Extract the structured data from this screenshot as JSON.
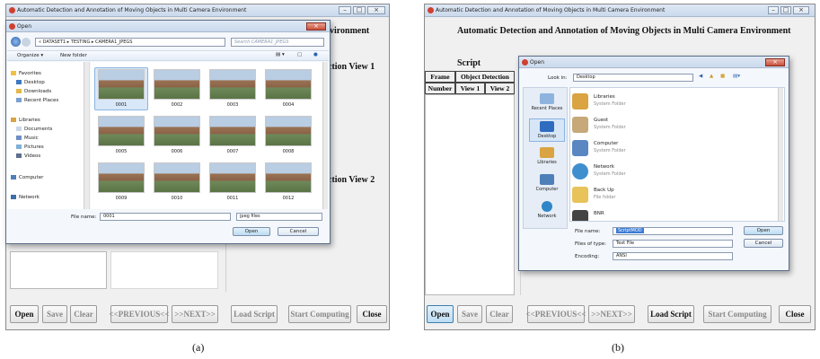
{
  "left": {
    "window_title": "Automatic Detection and Annotation of Moving Objects in Multi Camera Environment",
    "title_fragment": "vironment",
    "view1_label": "ction View 1",
    "view2_label": "ction View 2",
    "buttons": {
      "open": "Open",
      "save": "Save",
      "clear": "Clear",
      "previous": "<<PREVIOUS<<",
      "next": ">>NEXT>>",
      "load_script": "Load Script",
      "start_computing": "Start Computing",
      "close": "Close"
    },
    "dialog": {
      "title": "Open",
      "breadcrumb": "« DATASET1 ▸ TESTING ▸ CAMERA1_JPEGS",
      "search_placeholder": "Search CAMERA1_JPEGS",
      "organize": "Organize ▾",
      "new_folder": "New folder",
      "nav": [
        {
          "label": "Favorites",
          "icon": "star-icon"
        },
        {
          "label": "Desktop",
          "icon": "desktop-icon"
        },
        {
          "label": "Downloads",
          "icon": "downloads-icon"
        },
        {
          "label": "Recent Places",
          "icon": "recent-places-icon"
        },
        {
          "label": "Libraries",
          "icon": "libraries-icon"
        },
        {
          "label": "Documents",
          "icon": "documents-icon"
        },
        {
          "label": "Music",
          "icon": "music-icon"
        },
        {
          "label": "Pictures",
          "icon": "pictures-icon"
        },
        {
          "label": "Videos",
          "icon": "videos-icon"
        },
        {
          "label": "Computer",
          "icon": "computer-icon"
        },
        {
          "label": "Network",
          "icon": "network-icon"
        }
      ],
      "files": [
        "0001",
        "0002",
        "0003",
        "0004",
        "0005",
        "0006",
        "0007",
        "0008",
        "0009",
        "0010",
        "0011",
        "0012"
      ],
      "file_name_label": "File name:",
      "file_name_value": "0001",
      "file_type": "jpeg files",
      "open_btn": "Open",
      "cancel_btn": "Cancel"
    },
    "caption": "(a)"
  },
  "right": {
    "window_title": "Automatic Detection and Annotation of Moving Objects in Multi Camera Environment",
    "app_title": "Automatic Detection and Annotation of Moving Objects in Multi Camera Environment",
    "script_label": "Script",
    "table_headers": {
      "frame": "Frame",
      "number": "Number",
      "object_detection": "Object Detection",
      "view1": "View 1",
      "view2": "View 2"
    },
    "buttons": {
      "open": "Open",
      "save": "Save",
      "clear": "Clear",
      "previous": "<<PREVIOUS<<",
      "next": ">>NEXT>>",
      "load_script": "Load Script",
      "start_computing": "Start Computing",
      "close": "Close"
    },
    "dialog": {
      "title": "Open",
      "look_in_label": "Look in:",
      "look_in_value": "Desktop",
      "places": [
        "Recent Places",
        "Desktop",
        "Libraries",
        "Computer",
        "Network"
      ],
      "items": [
        {
          "name": "Libraries",
          "sub": "System Folder",
          "color": "#d9a441"
        },
        {
          "name": "Guest",
          "sub": "System Folder",
          "color": "#c7a878"
        },
        {
          "name": "Computer",
          "sub": "System Folder",
          "color": "#5a86c2"
        },
        {
          "name": "Network",
          "sub": "System Folder",
          "color": "#3f8fcf"
        },
        {
          "name": "Back Up",
          "sub": "File folder",
          "color": "#e7c35a"
        },
        {
          "name": "BNR",
          "sub": "",
          "color": "#444444"
        }
      ],
      "file_name_label": "File name:",
      "file_name_value": "ScriptMOD",
      "files_of_type_label": "Files of type:",
      "files_of_type_value": "Text File",
      "encoding_label": "Encoding:",
      "encoding_value": "ANSI",
      "open_btn": "Open",
      "cancel_btn": "Cancel"
    },
    "caption": "(b)"
  }
}
